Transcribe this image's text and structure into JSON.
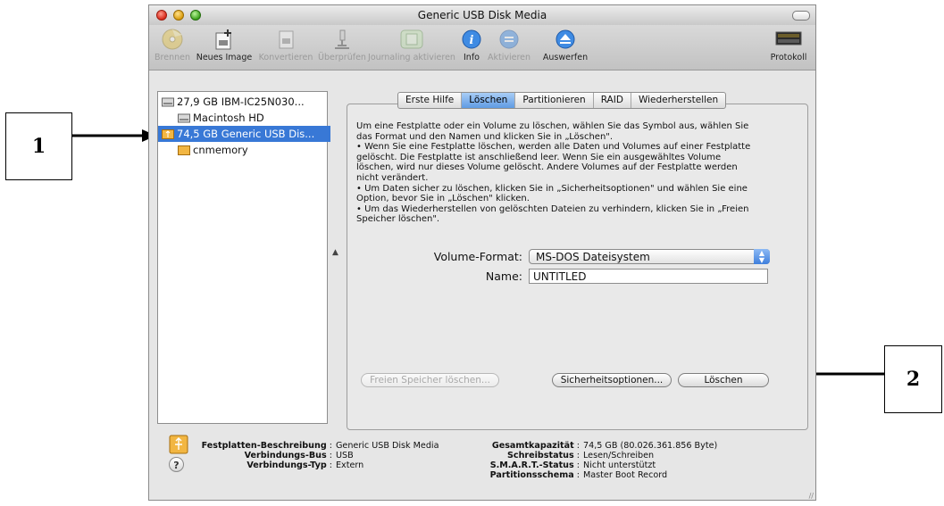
{
  "window": {
    "title": "Generic USB Disk Media"
  },
  "toolbar": {
    "items": [
      {
        "label": "Brennen",
        "icon": "burn-disc-icon",
        "enabled": false
      },
      {
        "label": "Neues Image",
        "icon": "new-image-icon",
        "enabled": true
      },
      {
        "label": "Konvertieren",
        "icon": "convert-icon",
        "enabled": false
      },
      {
        "label": "Überprüfen",
        "icon": "microscope-icon",
        "enabled": false
      },
      {
        "label": "Journaling aktivieren",
        "icon": "journaling-icon",
        "enabled": false
      },
      {
        "label": "Info",
        "icon": "info-icon",
        "enabled": true
      },
      {
        "label": "Aktivieren",
        "icon": "mount-icon",
        "enabled": false
      },
      {
        "label": "Auswerfen",
        "icon": "eject-icon",
        "enabled": true
      },
      {
        "label": "Protokoll",
        "icon": "log-icon",
        "enabled": true
      }
    ]
  },
  "sidebar": {
    "items": [
      {
        "label": "27,9 GB IBM-IC25N030...",
        "icon": "internal-disk-icon",
        "selected": false
      },
      {
        "label": "Macintosh HD",
        "icon": "volume-icon",
        "selected": false
      },
      {
        "label": "74,5 GB Generic USB Dis...",
        "icon": "usb-disk-icon",
        "selected": true
      },
      {
        "label": "cnmemory",
        "icon": "usb-volume-icon",
        "selected": false
      }
    ]
  },
  "tabs": [
    "Erste Hilfe",
    "Löschen",
    "Partitionieren",
    "RAID",
    "Wiederherstellen"
  ],
  "active_tab": "Löschen",
  "description": {
    "lines": [
      "Um eine Festplatte oder ein Volume zu löschen, wählen Sie das Symbol aus, wählen Sie",
      "das Format und den Namen und klicken Sie in „Löschen\".",
      "  • Wenn Sie eine Festplatte löschen, werden alle Daten und Volumes auf einer Festplatte",
      "gelöscht. Die Festplatte ist anschließend leer. Wenn Sie ein ausgewähltes Volume",
      "löschen, wird nur dieses Volume gelöscht. Andere Volumes auf der Festplatte werden",
      "nicht verändert.",
      "  • Um Daten sicher zu löschen, klicken Sie in „Sicherheitsoptionen\" und wählen Sie eine",
      "Option, bevor Sie in „Löschen\" klicken.",
      "  • Um das Wiederherstellen von gelöschten Dateien zu verhindern, klicken Sie in „Freien",
      "Speicher löschen\"."
    ]
  },
  "form": {
    "format_label": "Volume-Format:",
    "format_value": "MS-DOS Dateisystem",
    "name_label": "Name:",
    "name_value": "UNTITLED"
  },
  "buttons": {
    "free_space": "Freien Speicher löschen...",
    "security": "Sicherheitsoptionen...",
    "erase": "Löschen"
  },
  "disk_info": {
    "left": [
      {
        "key": "Festplatten-Beschreibung",
        "value": "Generic USB Disk Media"
      },
      {
        "key": "Verbindungs-Bus",
        "value": "USB"
      },
      {
        "key": "Verbindungs-Typ",
        "value": "Extern"
      }
    ],
    "right": [
      {
        "key": "Gesamtkapazität",
        "value": "74,5 GB (80.026.361.856 Byte)"
      },
      {
        "key": "Schreibstatus",
        "value": "Lesen/Schreiben"
      },
      {
        "key": "S.M.A.R.T.-Status",
        "value": "Nicht unterstützt"
      },
      {
        "key": "Partitionsschema",
        "value": "Master Boot Record"
      }
    ]
  },
  "help_label": "?",
  "annotations": {
    "one": "1",
    "two": "2"
  },
  "colors": {
    "selection": "#3878d6",
    "active_tab": "#5f9be3"
  }
}
